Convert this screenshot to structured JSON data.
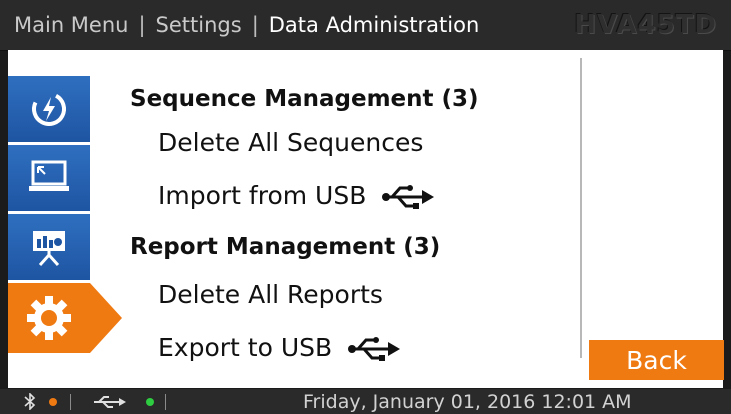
{
  "header": {
    "breadcrumbs": [
      "Main Menu",
      "Settings",
      "Data Administration"
    ],
    "separator": "|",
    "model": "HVA45TD"
  },
  "sidebar": {
    "items": [
      {
        "name": "power-icon",
        "active": false
      },
      {
        "name": "monitor-icon",
        "active": false
      },
      {
        "name": "report-presentation-icon",
        "active": false
      },
      {
        "name": "gear-icon",
        "active": true
      }
    ]
  },
  "content": {
    "sequence_heading": "Sequence Management (3)",
    "delete_sequences": "Delete All Sequences",
    "import_usb": "Import from USB",
    "report_heading": "Report Management (3)",
    "delete_reports": "Delete All Reports",
    "export_usb": "Export to USB"
  },
  "back_label": "Back",
  "statusbar": {
    "bluetooth_icon": "bluetooth-icon",
    "bluetooth_dot_color": "#f07a12",
    "usb_icon": "usb-icon",
    "usb_dot_color": "#2ecc40",
    "datetime": "Friday, January 01, 2016 12:01 AM"
  },
  "colors": {
    "accent": "#f07a12",
    "rail_blue": "#1e55a2"
  }
}
